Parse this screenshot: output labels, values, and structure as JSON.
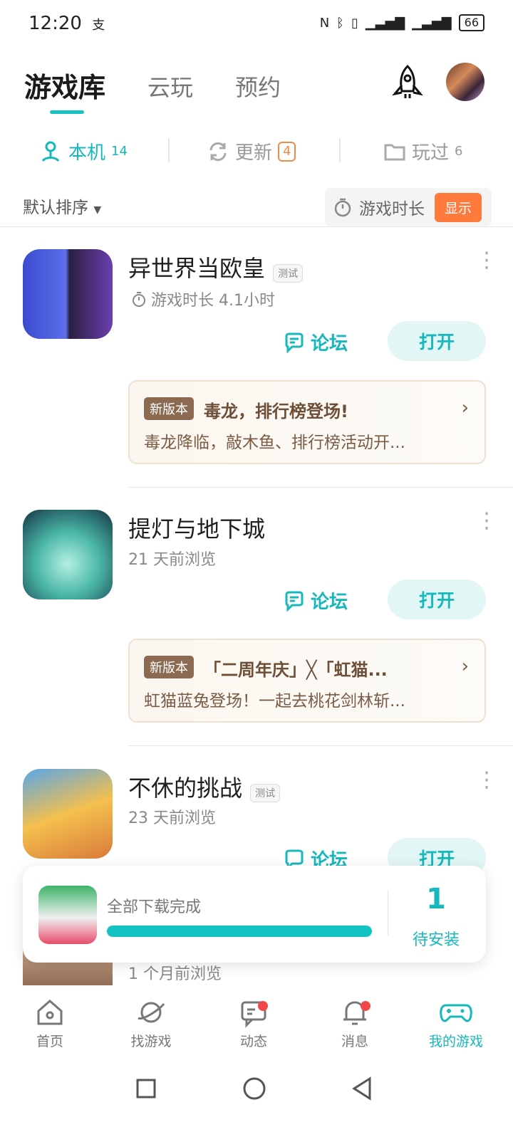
{
  "status": {
    "time": "12:20",
    "alipay_glyph": "支",
    "battery": "66"
  },
  "top_tabs": {
    "library": "游戏库",
    "cloud": "云玩",
    "reserve": "预约"
  },
  "sub_tabs": {
    "local": {
      "label": "本机",
      "count": "14"
    },
    "update": {
      "label": "更新",
      "count": "4"
    },
    "played": {
      "label": "玩过",
      "count": "6"
    }
  },
  "sort": {
    "label": "默认排序"
  },
  "time_toggle": {
    "label": "游戏时长",
    "button": "显示"
  },
  "games": [
    {
      "name": "异世界当欧皇",
      "tag": "测试",
      "sub": "游戏时长 4.1小时",
      "forum": "论坛",
      "open": "打开",
      "news": {
        "tag": "新版本",
        "title": "毒龙，排行榜登场!",
        "body": "毒龙降临，敲木鱼、排行榜活动开..."
      }
    },
    {
      "name": "提灯与地下城",
      "sub": "21 天前浏览",
      "forum": "论坛",
      "open": "打开",
      "news": {
        "tag": "新版本",
        "title": "「二周年庆」╳「虹猫...",
        "body": "虹猫蓝兔登场！一起去桃花剑林斩..."
      }
    },
    {
      "name": "不休的挑战",
      "tag": "测试",
      "sub": "23 天前浏览",
      "forum": "论坛",
      "open": "打开"
    },
    {
      "sub": "1 个月前浏览"
    }
  ],
  "download": {
    "status": "全部下载完成",
    "progress": 1.0,
    "count": "1",
    "label": "待安装"
  },
  "bottom_nav": {
    "home": "首页",
    "find": "找游戏",
    "feed": "动态",
    "messages": "消息",
    "mine": "我的游戏"
  },
  "colors": {
    "accent": "#16b8bc",
    "orange": "#ff7a3d",
    "news_brown": "#8c6a51"
  }
}
